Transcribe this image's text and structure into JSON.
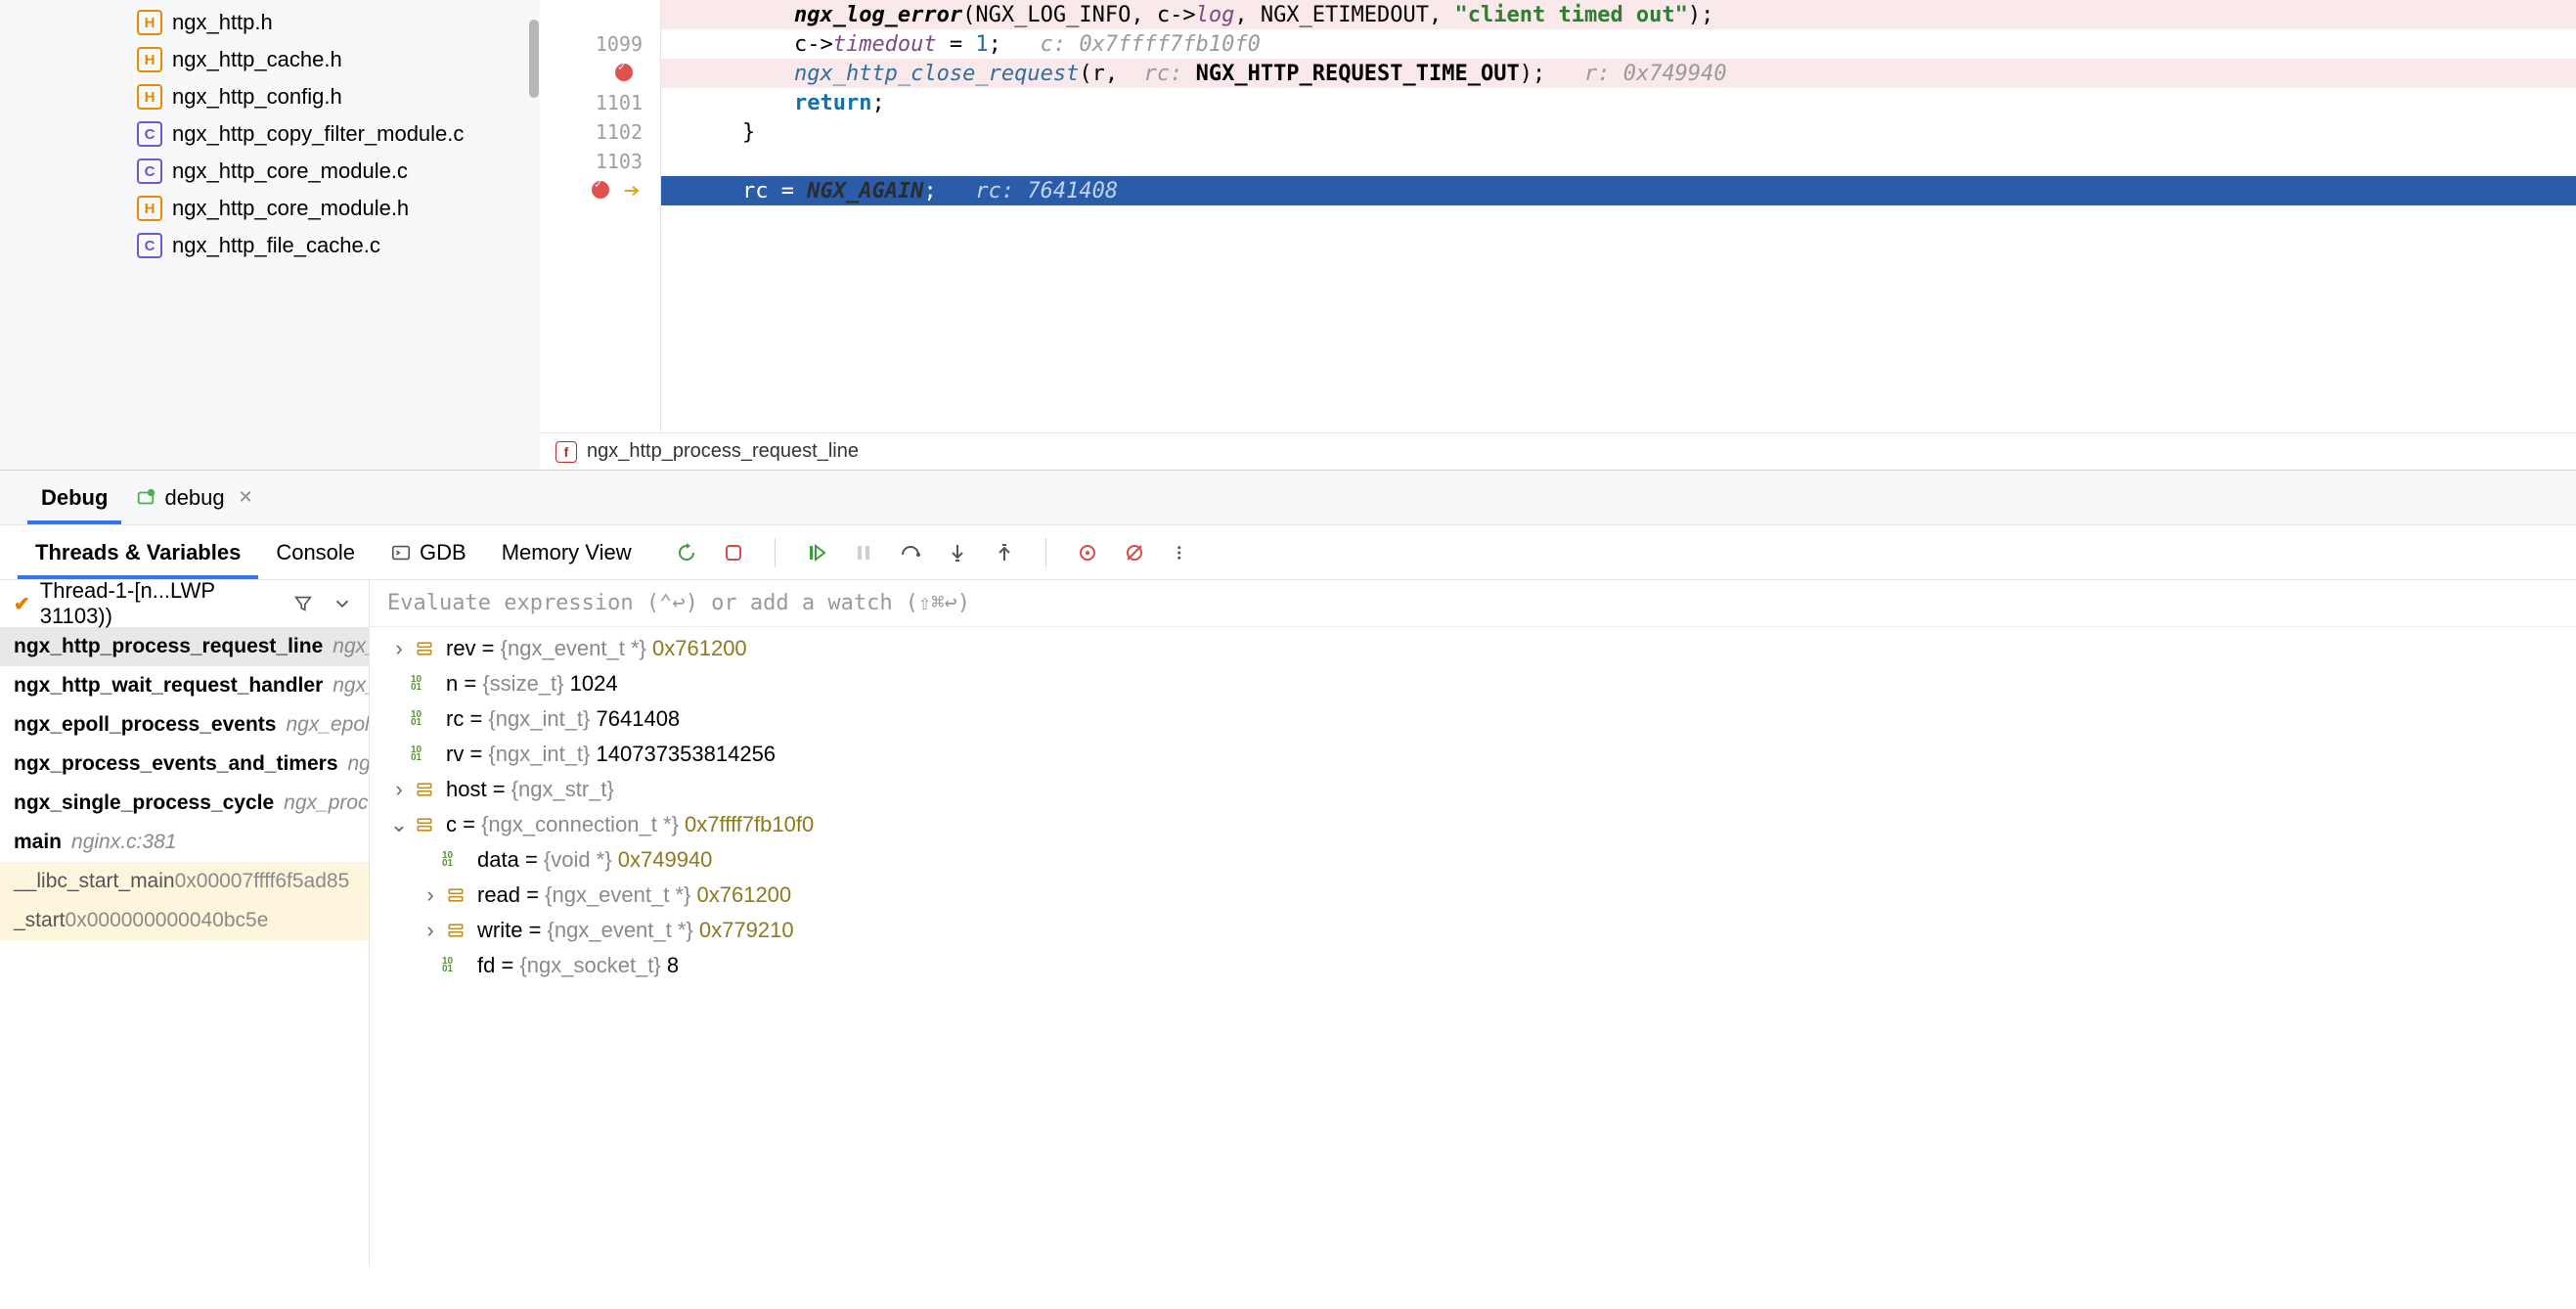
{
  "file_tree": [
    {
      "name": "ngx_http.h",
      "kind": "h"
    },
    {
      "name": "ngx_http_cache.h",
      "kind": "h"
    },
    {
      "name": "ngx_http_config.h",
      "kind": "h"
    },
    {
      "name": "ngx_http_copy_filter_module.c",
      "kind": "c"
    },
    {
      "name": "ngx_http_core_module.c",
      "kind": "c"
    },
    {
      "name": "ngx_http_core_module.h",
      "kind": "h"
    },
    {
      "name": "ngx_http_file_cache.c",
      "kind": "c"
    }
  ],
  "editor": {
    "status_fn": "ngx_http_process_request_line",
    "lines": [
      {
        "num": "",
        "bp": false,
        "cls": "hl-bp",
        "tokens": [
          {
            "t": "        ",
            "c": ""
          },
          {
            "t": "ngx_log_error",
            "c": "tok-fn-b"
          },
          {
            "t": "(NGX_LOG_INFO, c->",
            "c": ""
          },
          {
            "t": "log",
            "c": "tok-prop"
          },
          {
            "t": ", NGX_ETIMEDOUT, ",
            "c": ""
          },
          {
            "t": "\"client timed out\"",
            "c": "tok-str"
          },
          {
            "t": ");",
            "c": ""
          }
        ]
      },
      {
        "num": "1099",
        "bp": false,
        "cls": "",
        "tokens": [
          {
            "t": "        c->",
            "c": ""
          },
          {
            "t": "timedout",
            "c": "tok-prop"
          },
          {
            "t": " = ",
            "c": ""
          },
          {
            "t": "1",
            "c": "tok-num"
          },
          {
            "t": ";   ",
            "c": ""
          },
          {
            "t": "c: 0x7ffff7fb10f0",
            "c": "hint"
          }
        ]
      },
      {
        "num": "",
        "bp": true,
        "cls": "hl-bp",
        "tokens": [
          {
            "t": "        ",
            "c": ""
          },
          {
            "t": "ngx_http_close_request",
            "c": "tok-fn"
          },
          {
            "t": "(r,  ",
            "c": ""
          },
          {
            "t": "rc: ",
            "c": "hint"
          },
          {
            "t": "NGX_HTTP_REQUEST_TIME_OUT",
            "c": "hint-b"
          },
          {
            "t": ");   ",
            "c": ""
          },
          {
            "t": "r: 0x749940",
            "c": "hint"
          }
        ]
      },
      {
        "num": "1101",
        "bp": false,
        "cls": "",
        "tokens": [
          {
            "t": "        ",
            "c": ""
          },
          {
            "t": "return",
            "c": "tok-kw"
          },
          {
            "t": ";",
            "c": ""
          }
        ]
      },
      {
        "num": "1102",
        "bp": false,
        "cls": "",
        "tokens": [
          {
            "t": "    }",
            "c": ""
          }
        ]
      },
      {
        "num": "1103",
        "bp": false,
        "cls": "",
        "tokens": [
          {
            "t": "",
            "c": ""
          }
        ]
      },
      {
        "num": "",
        "bp": true,
        "exec": true,
        "cls": "hl-exec",
        "tokens": [
          {
            "t": "    rc = ",
            "c": ""
          },
          {
            "t": "NGX_AGAIN",
            "c": "tok-const"
          },
          {
            "t": ";   ",
            "c": ""
          },
          {
            "t": "rc: 7641408",
            "c": "hint"
          }
        ]
      }
    ]
  },
  "debug": {
    "primary_tab": "Debug",
    "run_tab": "debug",
    "sub_tabs": [
      "Threads & Variables",
      "Console",
      "GDB",
      "Memory View"
    ],
    "active_sub_tab": 0,
    "thread_label": "Thread-1-[n...LWP 31103))",
    "eval_placeholder": "Evaluate expression (⌃↩) or add a watch (⇧⌘↩)",
    "frames": [
      {
        "fn": "ngx_http_process_request_line",
        "loc": "ngx_http_r",
        "sel": true
      },
      {
        "fn": "ngx_http_wait_request_handler",
        "loc": "ngx_http_r"
      },
      {
        "fn": "ngx_epoll_process_events",
        "loc": "ngx_epoll_modu"
      },
      {
        "fn": "ngx_process_events_and_timers",
        "loc": "ngx_even"
      },
      {
        "fn": "ngx_single_process_cycle",
        "loc": "ngx_process_cy"
      },
      {
        "fn": "main",
        "loc": "nginx.c:381"
      },
      {
        "fn": "__libc_start_main",
        "loc": "0x00007ffff6f5ad85",
        "lib": true,
        "plain": true
      },
      {
        "fn": "_start",
        "loc": "0x000000000040bc5e",
        "lib": true,
        "plain": true
      }
    ],
    "vars": [
      {
        "depth": 0,
        "chev": "›",
        "ico": "struct",
        "name": "rev",
        "type": "{ngx_event_t *}",
        "val": "0x761200",
        "hex": true
      },
      {
        "depth": 0,
        "chev": "",
        "ico": "prim",
        "name": "n",
        "type": "{ssize_t}",
        "val": "1024"
      },
      {
        "depth": 0,
        "chev": "",
        "ico": "prim",
        "name": "rc",
        "type": "{ngx_int_t}",
        "val": "7641408"
      },
      {
        "depth": 0,
        "chev": "",
        "ico": "prim",
        "name": "rv",
        "type": "{ngx_int_t}",
        "val": "140737353814256"
      },
      {
        "depth": 0,
        "chev": "›",
        "ico": "struct",
        "name": "host",
        "type": "{ngx_str_t}",
        "val": ""
      },
      {
        "depth": 0,
        "chev": "⌄",
        "ico": "struct",
        "name": "c",
        "type": "{ngx_connection_t *}",
        "val": "0x7ffff7fb10f0",
        "hex": true
      },
      {
        "depth": 1,
        "chev": "",
        "ico": "prim",
        "name": "data",
        "type": "{void *}",
        "val": "0x749940",
        "hex": true
      },
      {
        "depth": 1,
        "chev": "›",
        "ico": "struct",
        "name": "read",
        "type": "{ngx_event_t *}",
        "val": "0x761200",
        "hex": true
      },
      {
        "depth": 1,
        "chev": "›",
        "ico": "struct",
        "name": "write",
        "type": "{ngx_event_t *}",
        "val": "0x779210",
        "hex": true
      },
      {
        "depth": 1,
        "chev": "",
        "ico": "prim",
        "name": "fd",
        "type": "{ngx_socket_t}",
        "val": "8"
      }
    ]
  }
}
